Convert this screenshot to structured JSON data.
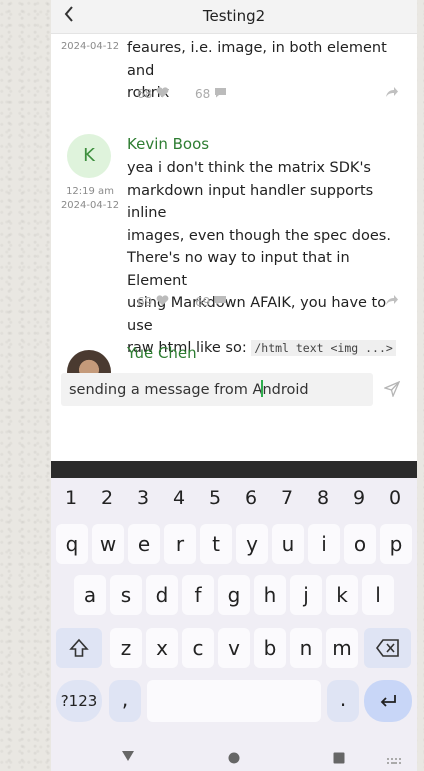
{
  "header": {
    "back_icon": "chevron-left-icon",
    "title": "Testing2"
  },
  "messages": [
    {
      "date": "2024-04-12",
      "lines": [
        "feaures, i.e. image, in both element and",
        "robrix"
      ],
      "likes": "68",
      "comments": "68"
    },
    {
      "avatar_letter": "K",
      "sender": "Kevin Boos",
      "time": "12:19 am",
      "date": "2024-04-12",
      "lines": [
        "yea i don't think the matrix SDK's",
        "markdown input handler supports inline",
        "images, even though the spec does.",
        "There's no way to input that in Element",
        "using Markdown AFAIK, you have to use"
      ],
      "last_line_prefix": "raw html like so: ",
      "code": "/html  text <img ...>",
      "likes": "69",
      "comments": "69"
    },
    {
      "sender": "Yue Chen"
    }
  ],
  "composer": {
    "text_before": "sending a message from A",
    "text_after": "ndroid"
  },
  "keyboard": {
    "row_numbers": [
      "1",
      "2",
      "3",
      "4",
      "5",
      "6",
      "7",
      "8",
      "9",
      "0"
    ],
    "row1": [
      "q",
      "w",
      "e",
      "r",
      "t",
      "y",
      "u",
      "i",
      "o",
      "p"
    ],
    "row2": [
      "a",
      "s",
      "d",
      "f",
      "g",
      "h",
      "j",
      "k",
      "l"
    ],
    "row3": [
      "z",
      "x",
      "c",
      "v",
      "b",
      "n",
      "m"
    ],
    "symbols": "?123",
    "comma": ",",
    "period": "."
  },
  "icons": {
    "heart": "heart-icon",
    "comment": "comment-icon",
    "share": "share-icon",
    "send": "send-icon",
    "shift": "shift-icon",
    "backspace": "backspace-icon",
    "enter": "enter-icon"
  },
  "colors": {
    "sender_green": "#2e7d32",
    "avatar_bg": "#dff3dc",
    "caret": "#2eae4d"
  }
}
